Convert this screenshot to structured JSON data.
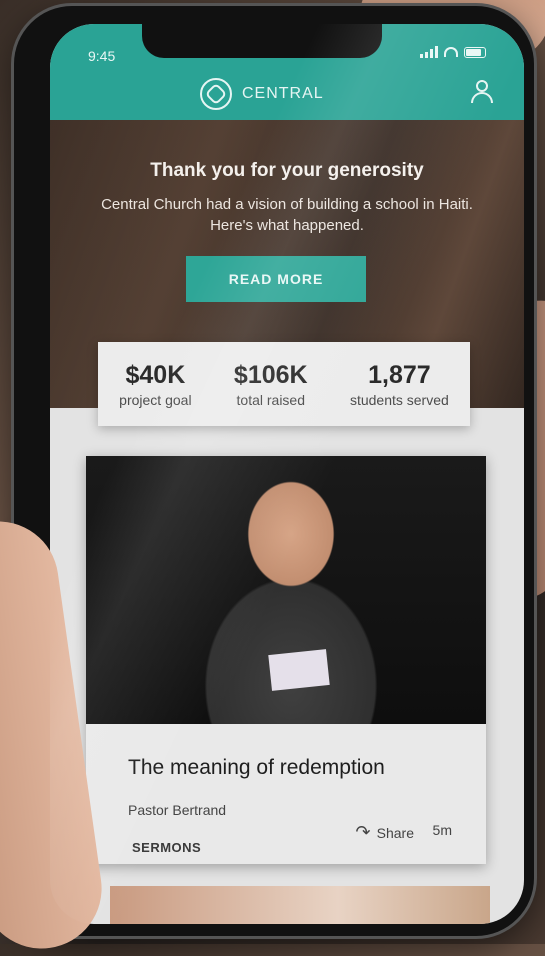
{
  "status_bar": {
    "time": "9:45"
  },
  "app_header": {
    "brand": "CENTRAL"
  },
  "hero": {
    "title": "Thank you for your generosity",
    "subtitle": "Central Church had a vision of building a school in Haiti. Here's what happened.",
    "cta_label": "READ MORE"
  },
  "stats": [
    {
      "value": "$40K",
      "label": "project goal"
    },
    {
      "value": "$106K",
      "label": "total raised"
    },
    {
      "value": "1,877",
      "label": "students served"
    }
  ],
  "card": {
    "title": "The meaning of redemption",
    "author": "Pastor Bertrand",
    "category": "SERMONS",
    "share_label": "Share",
    "duration": "5m"
  },
  "icons": {
    "logo": "central-logo-icon",
    "profile": "user-icon",
    "share": "share-arrow-icon"
  },
  "colors": {
    "accent": "#2aa395",
    "button": "#2ea697"
  }
}
